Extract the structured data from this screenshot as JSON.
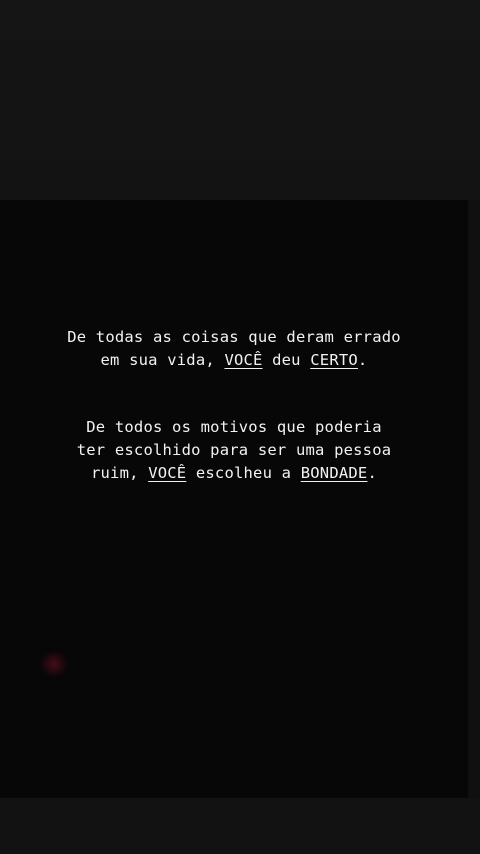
{
  "story": {
    "paragraph_1": {
      "line_1": "De todas as coisas que deram errado",
      "line_2_prefix": "em sua vida, ",
      "line_2_you": "VOCÊ",
      "line_2_mid": " deu ",
      "line_2_right": "CERTO",
      "line_2_end": "."
    },
    "paragraph_2": {
      "line_1": "De todos os motivos que poderia",
      "line_2": "ter escolhido para ser uma pessoa",
      "line_3_prefix": "ruim, ",
      "line_3_you": "VOCÊ",
      "line_3_mid": " escolheu a ",
      "line_3_kindness": "BONDADE",
      "line_3_end": "."
    }
  },
  "colors": {
    "background": "#121212",
    "photo": "#070707",
    "text": "#f2f2f2",
    "heart_glow": "#6e1428"
  },
  "icons": [
    "heart-icon"
  ]
}
